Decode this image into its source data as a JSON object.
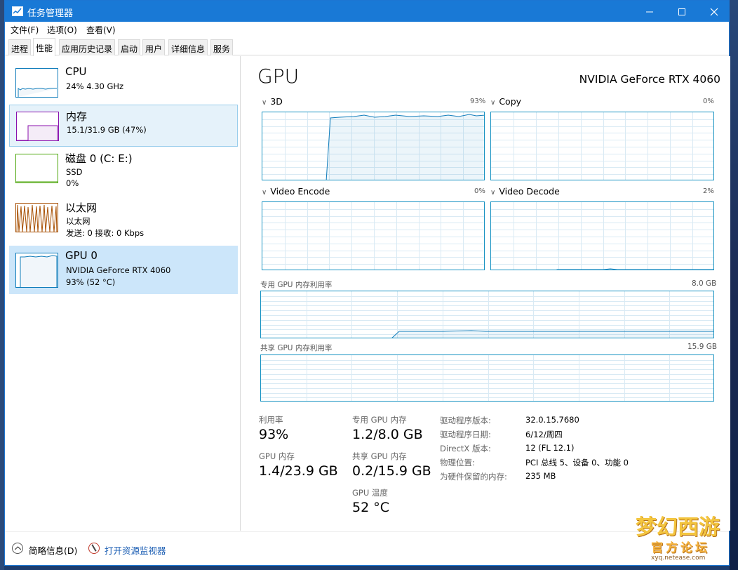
{
  "window": {
    "title": "任务管理器"
  },
  "menu": [
    "文件(F)",
    "选项(O)",
    "查看(V)"
  ],
  "tabs": [
    "进程",
    "性能",
    "应用历史记录",
    "启动",
    "用户",
    "详细信息",
    "服务"
  ],
  "active_tab": "性能",
  "sidebar": {
    "items": [
      {
        "name": "CPU",
        "sub1": "24% 4.30 GHz",
        "sub2": "",
        "color": "#117dbb"
      },
      {
        "name": "内存",
        "sub1": "15.1/31.9 GB (47%)",
        "sub2": "",
        "color": "#8b12ae"
      },
      {
        "name": "磁盘 0 (C: E:)",
        "sub1": "SSD",
        "sub2": "0%",
        "color": "#4da60c"
      },
      {
        "name": "以太网",
        "sub1": "以太网",
        "sub2": "发送: 0 接收: 0 Kbps",
        "color": "#a74f01"
      },
      {
        "name": "GPU 0",
        "sub1": "NVIDIA GeForce RTX 4060",
        "sub2": "93% (52 °C)",
        "color": "#117dbb"
      }
    ]
  },
  "gpu": {
    "title": "GPU",
    "model": "NVIDIA GeForce RTX 4060",
    "engines": [
      {
        "label": "3D",
        "pct": "93%"
      },
      {
        "label": "Copy",
        "pct": "0%"
      },
      {
        "label": "Video Encode",
        "pct": "0%"
      },
      {
        "label": "Video Decode",
        "pct": "2%"
      }
    ],
    "dedicated_label": "专用 GPU 内存利用率",
    "dedicated_max": "8.0 GB",
    "shared_label": "共享 GPU 内存利用率",
    "shared_max": "15.9 GB",
    "stats": {
      "util_label": "利用率",
      "util_value": "93%",
      "gpu_mem_label": "GPU 内存",
      "gpu_mem_value": "1.4/23.9 GB",
      "ded_label": "专用 GPU 内存",
      "ded_value": "1.2/8.0 GB",
      "shared_label": "共享 GPU 内存",
      "shared_value": "0.2/15.9 GB",
      "temp_label": "GPU 温度",
      "temp_value": "52 °C"
    },
    "details": [
      {
        "k": "驱动程序版本:",
        "v": "32.0.15.7680"
      },
      {
        "k": "驱动程序日期:",
        "v": "6/12/周四"
      },
      {
        "k": "DirectX 版本:",
        "v": "12 (FL 12.1)"
      },
      {
        "k": "物理位置:",
        "v": "PCI 总线 5、设备 0、功能 0"
      },
      {
        "k": "为硬件保留的内存:",
        "v": "235 MB"
      }
    ]
  },
  "bottom": {
    "summary": "简略信息(D)",
    "monitor": "打开资源监视器"
  },
  "watermark": {
    "line1": "梦幻西游",
    "line2": "官方论坛",
    "line3": "xyq.netease.com"
  }
}
